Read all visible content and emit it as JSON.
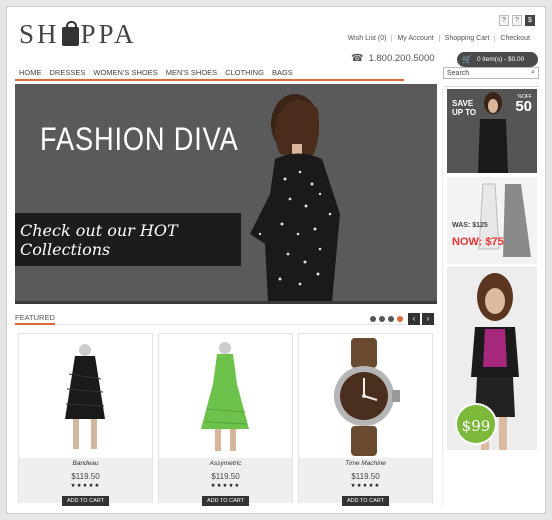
{
  "brand": {
    "logo_pre": "SH",
    "logo_post": "PPA"
  },
  "util_icons": [
    "?",
    "?",
    "$"
  ],
  "toplinks": [
    "Wish List (0)",
    "My Account",
    "Shopping Cart",
    "Checkout"
  ],
  "phone": "1.800.200.5000",
  "cart": {
    "label": "0 item(s) - $0.00"
  },
  "nav": [
    "HOME",
    "DRESSES",
    "WOMEN'S SHOES",
    "MEN'S SHOES",
    "CLOTHING",
    "BAGS"
  ],
  "search": {
    "placeholder": "Search"
  },
  "hero": {
    "title": "FASHION DIVA",
    "banner": "Check out our HOT Collections"
  },
  "featured": {
    "label": "FEATURED"
  },
  "carousel": {
    "dots": 4,
    "active": 3,
    "prev": "‹",
    "next": "›"
  },
  "products": [
    {
      "name": "Bandeau",
      "price": "$119.50",
      "stars": "★★★★★",
      "button": "ADD TO CART"
    },
    {
      "name": "Assymetric",
      "price": "$119.50",
      "stars": "★★★★★",
      "button": "ADD TO CART"
    },
    {
      "name": "Time Machine",
      "price": "$119.50",
      "stars": "★★★★★",
      "button": "ADD TO CART"
    }
  ],
  "ads": {
    "ad1": {
      "save": "SAVE",
      "upto": "UP TO",
      "off": "%OFF",
      "pct": "50"
    },
    "ad2": {
      "was": "WAS: $125",
      "now": "NOW: $75"
    },
    "ad3": {
      "price": "$99"
    }
  },
  "colors": {
    "accent": "#e0683b",
    "dark": "#333333",
    "badge": "#7cb83a"
  }
}
